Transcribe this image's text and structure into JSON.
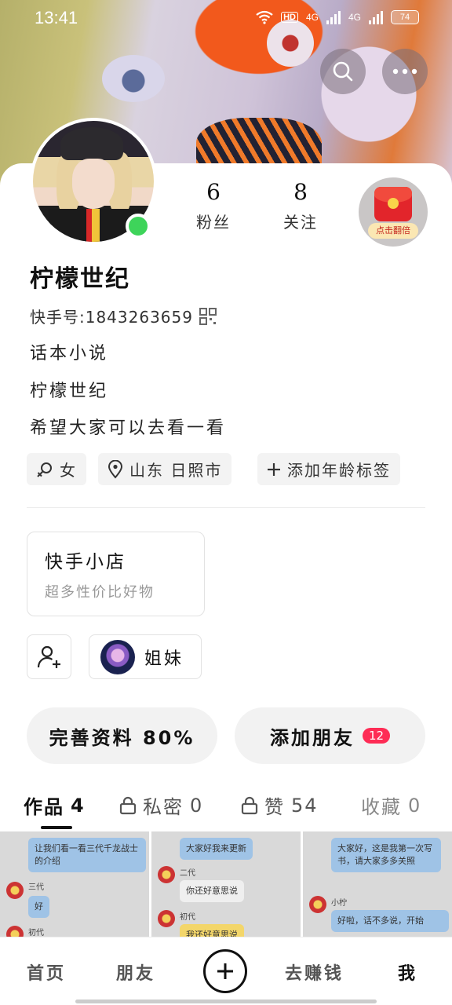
{
  "status": {
    "time": "13:41",
    "network": "4G",
    "hd": "HD",
    "battery": "74"
  },
  "profile": {
    "name": "柠檬世纪",
    "kuaishou_id": "快手号:1843263659",
    "bio": [
      "话本小说",
      "柠檬世纪",
      "希望大家可以去看一看"
    ],
    "stats": {
      "fans_count": "6",
      "fans_label": "粉丝",
      "follow_count": "8",
      "follow_label": "关注"
    },
    "redpacket_label": "点击翻倍"
  },
  "tags": {
    "gender": "女",
    "location": "山东 日照市",
    "age": "添加年龄标签"
  },
  "shop": {
    "title": "快手小店",
    "subtitle": "超多性价比好物"
  },
  "group": {
    "name": "姐妹"
  },
  "actions": {
    "complete_profile": "完善资料 80%",
    "add_friend": "添加朋友",
    "add_friend_badge": "12"
  },
  "tabs": [
    {
      "label": "作品",
      "count": "4"
    },
    {
      "label": "私密",
      "count": "0"
    },
    {
      "label": "赞",
      "count": "54"
    },
    {
      "label": "收藏",
      "count": "0"
    }
  ],
  "thumbs": [
    {
      "bubble1": "让我们看一看三代千龙战士的介绍",
      "name1": "三代",
      "bubble2": "好",
      "name2": "初代"
    },
    {
      "bubble1": "大家好我来更新",
      "name1": "二代",
      "bubble2": "你还好意思说",
      "name2": "初代",
      "bubble3": "我还好意思说"
    },
    {
      "bubble1": "大家好，这是我第一次写书，请大家多多关照",
      "name1": "小柠",
      "bubble2": "好啦，话不多说，开始"
    }
  ],
  "nav": {
    "home": "首页",
    "friends": "朋友",
    "earn": "去赚钱",
    "me": "我"
  },
  "colors": {
    "online": "#3ed45a",
    "badge": "#fe2c55",
    "text": "#111111"
  }
}
